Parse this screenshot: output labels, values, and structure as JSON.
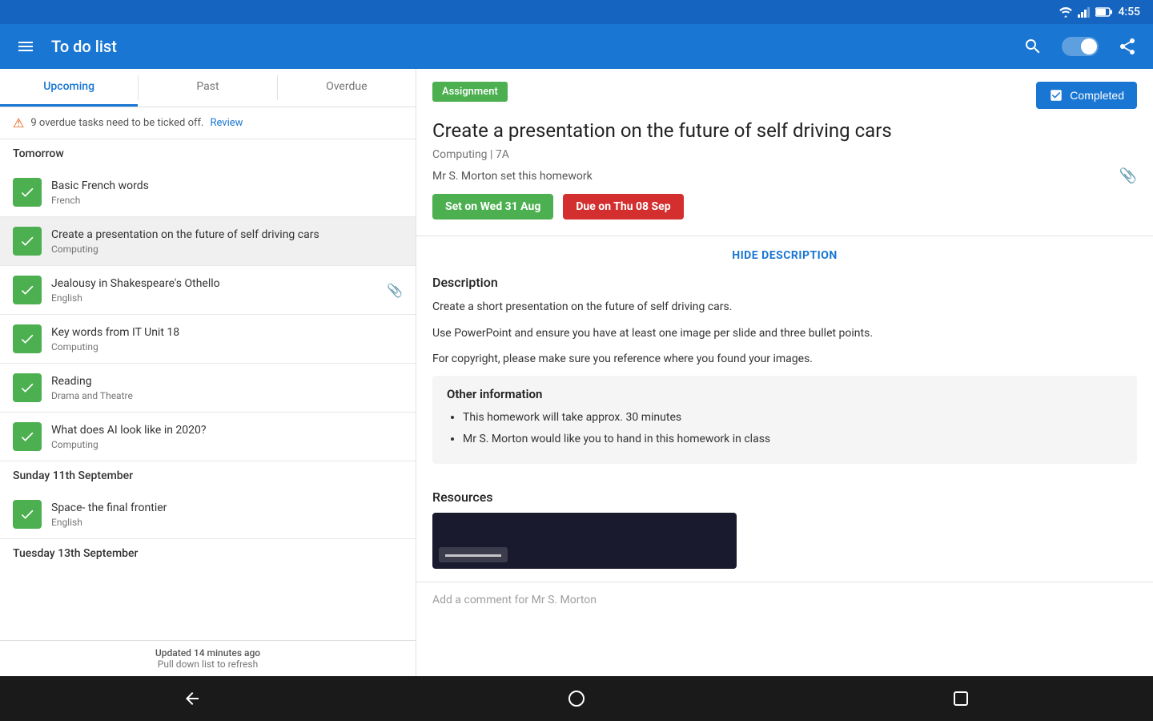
{
  "statusBar": {
    "time": "4:55"
  },
  "appBar": {
    "menuLabel": "☰",
    "title": "To do list",
    "searchLabel": "search",
    "toggleLabel": "toggle",
    "shareLabel": "share"
  },
  "tabs": [
    {
      "label": "Upcoming",
      "active": true
    },
    {
      "label": "Past",
      "active": false
    },
    {
      "label": "Overdue",
      "active": false
    }
  ],
  "warningBar": {
    "message": "9 overdue tasks need to be ticked off.",
    "reviewLabel": "Review"
  },
  "sections": [
    {
      "header": "Tomorrow",
      "tasks": [
        {
          "title": "Basic French words",
          "subject": "French",
          "checked": true,
          "selected": false,
          "attachment": false
        },
        {
          "title": "Create a presentation on the future of self driving cars",
          "subject": "Computing",
          "checked": true,
          "selected": true,
          "attachment": false
        },
        {
          "title": "Jealousy in Shakespeare's Othello",
          "subject": "English",
          "checked": true,
          "selected": false,
          "attachment": true
        },
        {
          "title": "Key words from IT Unit 18",
          "subject": "Computing",
          "checked": true,
          "selected": false,
          "attachment": false
        },
        {
          "title": "Reading",
          "subject": "Drama and Theatre",
          "checked": true,
          "selected": false,
          "attachment": false
        },
        {
          "title": "What does AI look like in 2020?",
          "subject": "Computing",
          "checked": true,
          "selected": false,
          "attachment": false
        }
      ]
    },
    {
      "header": "Sunday 11th September",
      "tasks": [
        {
          "title": "Space- the final frontier",
          "subject": "English",
          "checked": true,
          "selected": false,
          "attachment": false
        }
      ]
    },
    {
      "header": "Tuesday 13th September",
      "tasks": []
    }
  ],
  "listFooter": {
    "updatedText": "Updated 14 minutes ago",
    "refreshText": "Pull down list to refresh"
  },
  "assignment": {
    "badge": "Assignment",
    "completedLabel": "Completed",
    "title": "Create a presentation on the future of self driving cars",
    "meta": "Computing | 7A",
    "teacher": "Mr S. Morton set this homework",
    "setDate": "Set on ",
    "setDateBold": "Wed 31 Aug",
    "dueDate": "Due on ",
    "dueDateBold": "Thu 08 Sep",
    "hideDescription": "HIDE DESCRIPTION",
    "descriptionTitle": "Description",
    "descriptionLines": [
      "Create a short presentation on the future of self driving cars.",
      "Use PowerPoint and ensure you have at least one image per slide and three bullet points.",
      "For copyright, please make sure you reference where you found your images."
    ],
    "otherInfoTitle": "Other information",
    "otherInfoItems": [
      "This homework will take approx. 30 minutes",
      "Mr S. Morton would like you to hand in this homework in class"
    ],
    "resourcesTitle": "Resources",
    "commentPlaceholder": "Add a comment for Mr S. Morton"
  }
}
